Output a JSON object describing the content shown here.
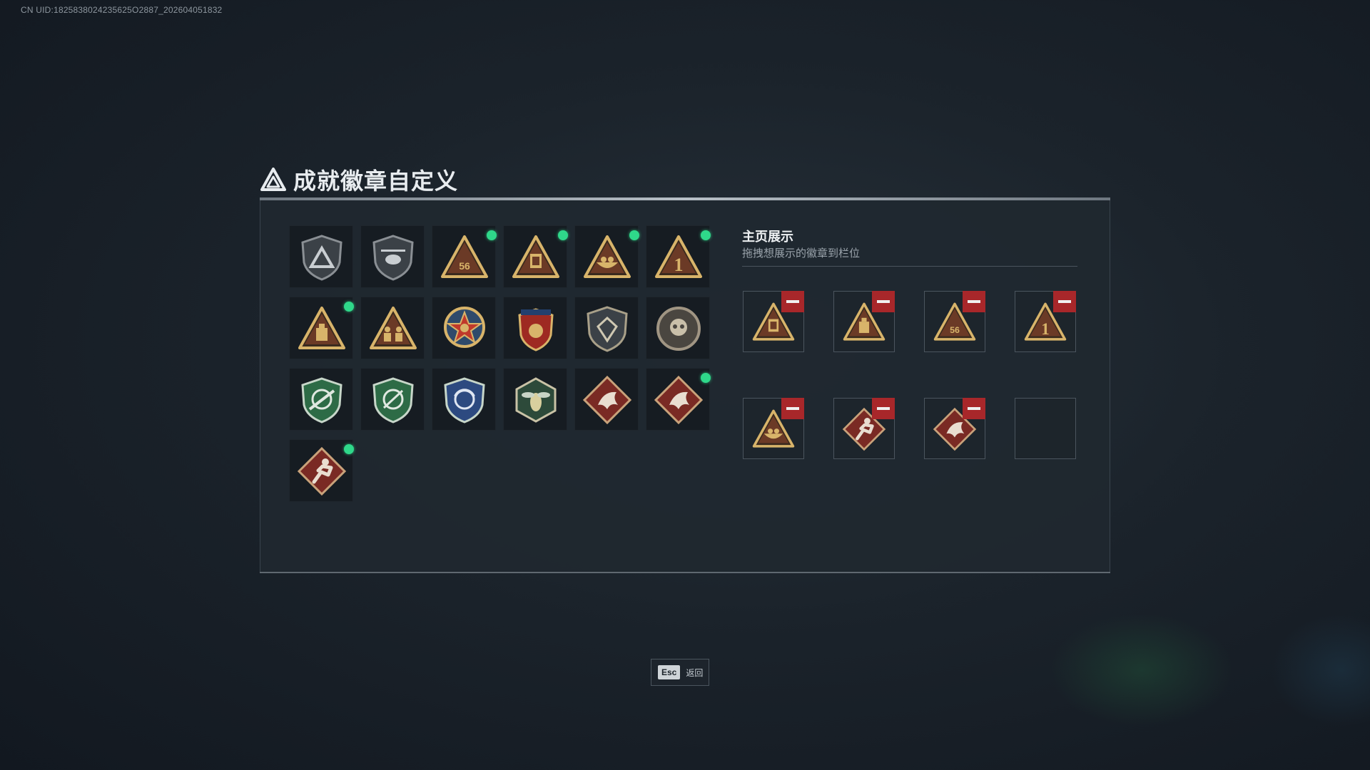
{
  "uid_text": "CN UID:1825838024235625O2887_202604051832",
  "title": "成就徽章自定义",
  "showcase": {
    "title": "主页展示",
    "subtitle": "拖拽想展示的徽章到栏位"
  },
  "badges": [
    {
      "icon": "shield-triangle-logo-icon",
      "new": false
    },
    {
      "icon": "helicopter-shield-icon",
      "new": false
    },
    {
      "icon": "triangle-56-icon",
      "new": true
    },
    {
      "icon": "triangle-lantern-icon",
      "new": true
    },
    {
      "icon": "triangle-bowl-icon",
      "new": true
    },
    {
      "icon": "triangle-number-1-icon",
      "new": true
    },
    {
      "icon": "triangle-crate-icon",
      "new": true
    },
    {
      "icon": "triangle-soldiers-icon",
      "new": false
    },
    {
      "icon": "star-wreath-medal-icon",
      "new": false
    },
    {
      "icon": "eagle-shield-medal-icon",
      "new": false
    },
    {
      "icon": "gem-shield-icon",
      "new": false
    },
    {
      "icon": "skull-coin-icon",
      "new": false
    },
    {
      "icon": "green-crosshair-rifle-shield-icon",
      "new": false
    },
    {
      "icon": "green-crosshair-knife-shield-icon",
      "new": false
    },
    {
      "icon": "blue-crosshair-shield-icon",
      "new": false
    },
    {
      "icon": "wasp-hexagon-icon",
      "new": false
    },
    {
      "icon": "dragon-diamond-icon",
      "new": false
    },
    {
      "icon": "dragon-diamond-icon",
      "new": true
    },
    {
      "icon": "runner-diamond-icon",
      "new": true
    }
  ],
  "slots": [
    {
      "icon": "triangle-lantern-icon",
      "filled": true
    },
    {
      "icon": "triangle-crate-icon",
      "filled": true
    },
    {
      "icon": "triangle-56-icon",
      "filled": true
    },
    {
      "icon": "triangle-number-1-icon",
      "filled": true
    },
    {
      "icon": "triangle-bowl-icon",
      "filled": true
    },
    {
      "icon": "runner-diamond-icon",
      "filled": true
    },
    {
      "icon": "dragon-diamond-icon",
      "filled": true
    },
    {
      "icon": "",
      "filled": false
    }
  ],
  "esc": {
    "key": "Esc",
    "label": "返回"
  },
  "colors": {
    "accent_new": "#2fd88a",
    "remove": "#a8272a",
    "gold": "#d8b46a",
    "badge_red": "#7a2a24"
  }
}
